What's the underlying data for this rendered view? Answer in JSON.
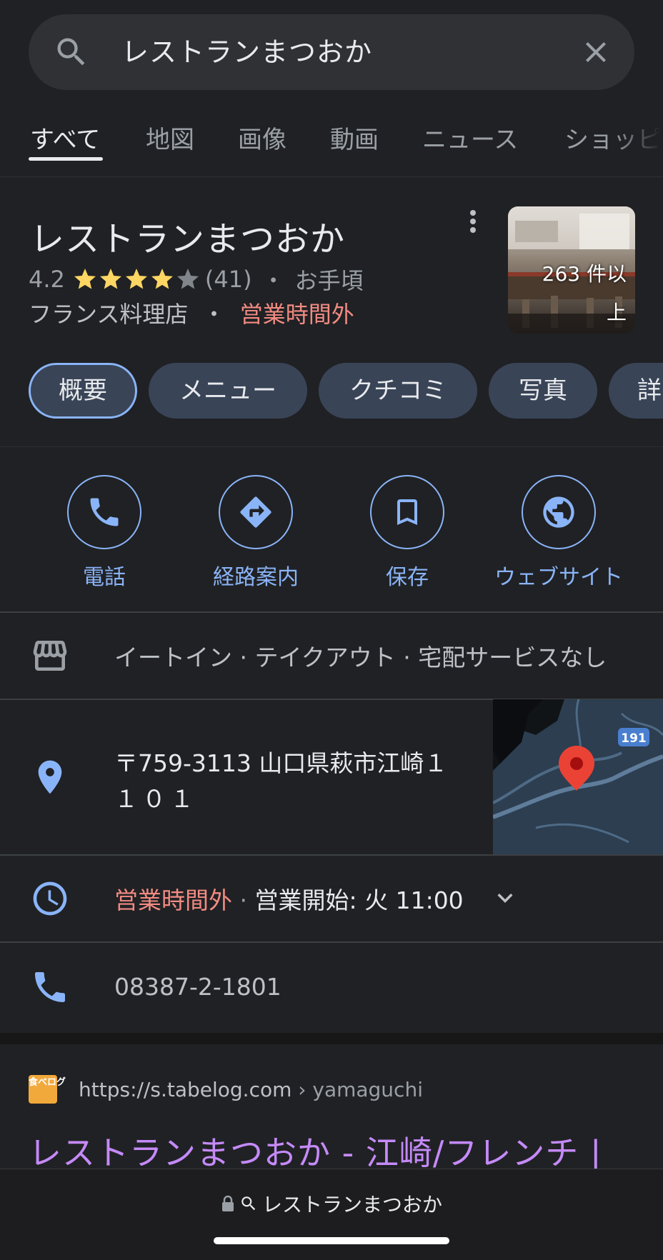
{
  "search": {
    "query": "レストランまつおか"
  },
  "tabs": [
    {
      "label": "すべて",
      "active": true
    },
    {
      "label": "地図"
    },
    {
      "label": "画像"
    },
    {
      "label": "動画"
    },
    {
      "label": "ニュース"
    },
    {
      "label": "ショッピ"
    }
  ],
  "business": {
    "name": "レストランまつおか",
    "rating": "4.2",
    "rating_value": 4.2,
    "reviews": "(41)",
    "sep": "・",
    "price": "お手頃",
    "category": "フランス料理店",
    "status": "営業時間外",
    "photo_count": "263 件以上"
  },
  "chips": [
    "概要",
    "メニュー",
    "クチコミ",
    "写真",
    "詳"
  ],
  "actions": [
    {
      "label": "電話",
      "icon": "phone-icon"
    },
    {
      "label": "経路案内",
      "icon": "directions-icon"
    },
    {
      "label": "保存",
      "icon": "bookmark-icon"
    },
    {
      "label": "ウェブサイト",
      "icon": "globe-icon"
    }
  ],
  "info": {
    "service_options": "イートイン · テイクアウト · 宅配サービスなし",
    "address_line1": "〒759-3113 山口県萩市江崎１",
    "address_line2": "１０１",
    "hours_status": "営業時間外",
    "hours_sep": " · ",
    "hours_detail": "営業開始: 火 11:00",
    "phone": "08387-2-1801",
    "map_route": "191"
  },
  "result": {
    "favicon_text": "食べログ",
    "url": "https://s.tabelog.com",
    "crumb": " › yamaguchi",
    "title": "レストランまつおか - 江崎/フレンチ |"
  },
  "browser": {
    "address": "レストランまつおか"
  },
  "colors": {
    "accent": "#8ab4f8",
    "closed": "#f28b82",
    "star": "#fdd663",
    "visited": "#c58af9"
  }
}
